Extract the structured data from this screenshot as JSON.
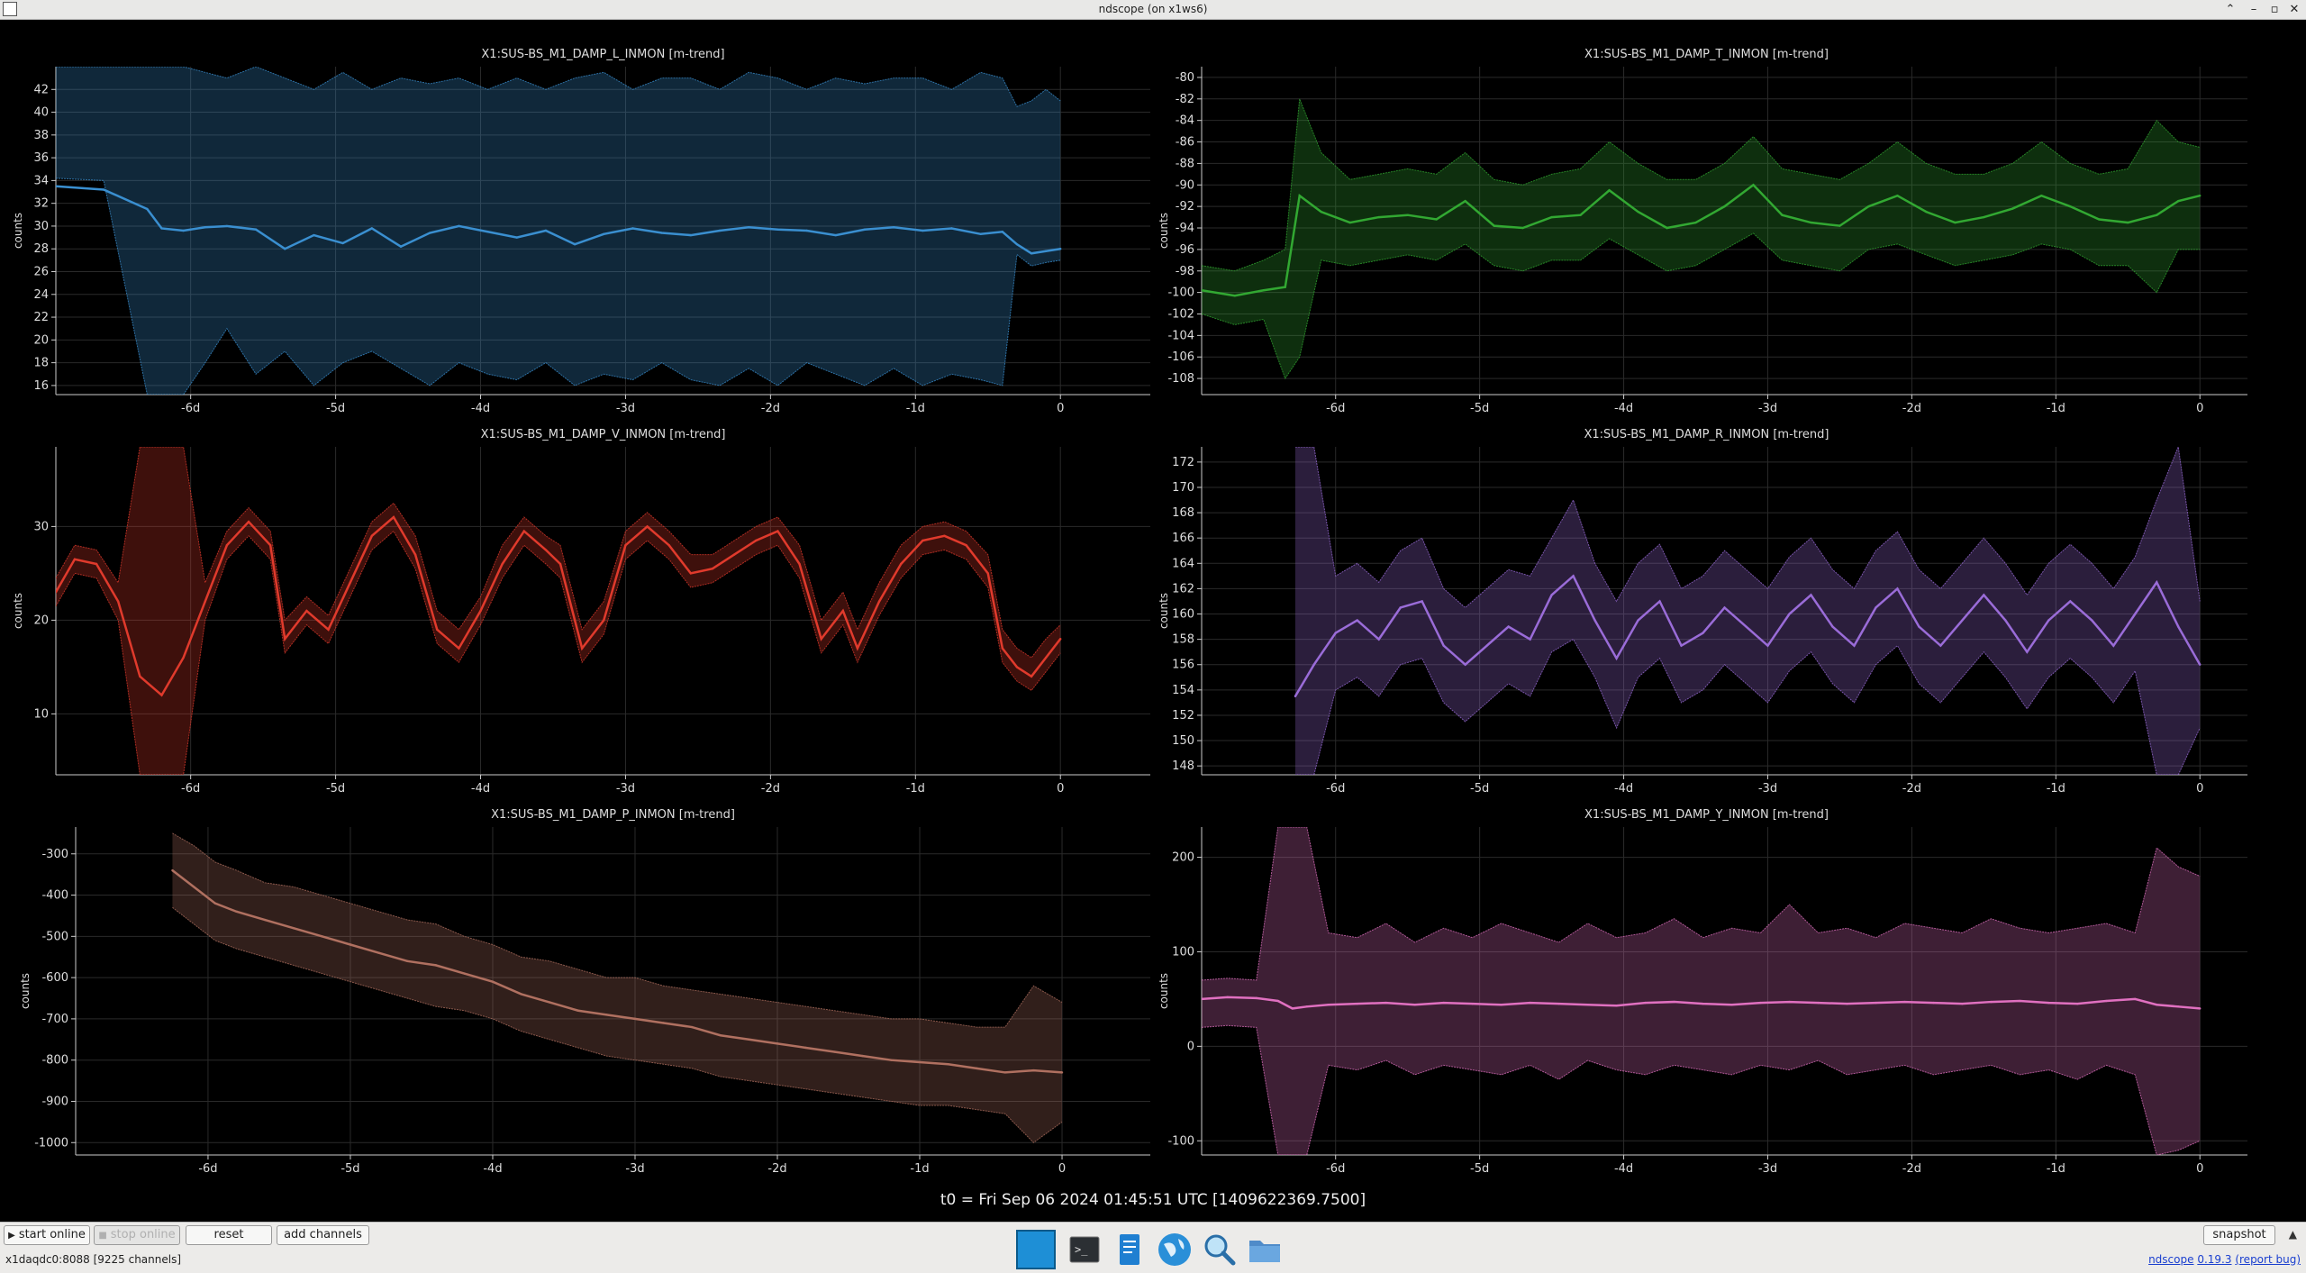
{
  "window": {
    "title": "ndscope (on x1ws6)"
  },
  "colors": {
    "background": "#000000",
    "axis": "#cccccc",
    "grid": "#2a2a2a"
  },
  "t0_label": "t0 = Fri Sep 06 2024 01:45:51 UTC [1409622369.7500]",
  "toolbar": {
    "start_online": "start online",
    "stop_online": "stop online",
    "reset": "reset",
    "add_channels": "add channels",
    "snapshot": "snapshot"
  },
  "status": {
    "server": "x1daqdc0:8088  [9225 channels]",
    "version_app": "ndscope",
    "version_num": "0.19.3",
    "report_bug": "(report bug)"
  },
  "dock_icons": [
    "desktop-icon",
    "terminal-icon",
    "text-editor-icon",
    "browser-globe-icon",
    "search-icon",
    "file-manager-icon"
  ],
  "chart_data": [
    {
      "type": "line",
      "title": "X1:SUS-BS_M1_DAMP_L_INMON [m-trend]",
      "ylabel": "counts",
      "color": "#3a8fd0",
      "xticks": [
        -6,
        -5,
        -4,
        -3,
        -2,
        -1,
        0
      ],
      "xtick_labels": [
        "-6d",
        "-5d",
        "-4d",
        "-3d",
        "-2d",
        "-1d",
        "0"
      ],
      "xlim": [
        -6.93,
        0.62
      ],
      "ylim": [
        15.2,
        44
      ],
      "yticks": [
        16,
        18,
        20,
        22,
        24,
        26,
        28,
        30,
        32,
        34,
        36,
        38,
        40,
        42
      ],
      "x": [
        -6.93,
        -6.6,
        -6.3,
        -6.2,
        -6.05,
        -5.9,
        -5.75,
        -5.55,
        -5.35,
        -5.15,
        -4.95,
        -4.75,
        -4.55,
        -4.35,
        -4.15,
        -3.95,
        -3.75,
        -3.55,
        -3.35,
        -3.15,
        -2.95,
        -2.75,
        -2.55,
        -2.35,
        -2.15,
        -1.95,
        -1.75,
        -1.55,
        -1.35,
        -1.15,
        -0.95,
        -0.75,
        -0.55,
        -0.4,
        -0.3,
        -0.2,
        -0.1,
        0
      ],
      "mean": [
        33.5,
        33.2,
        31.5,
        29.8,
        29.6,
        29.9,
        30.0,
        29.7,
        28.0,
        29.2,
        28.5,
        29.8,
        28.2,
        29.4,
        30.0,
        29.5,
        29.0,
        29.6,
        28.4,
        29.3,
        29.8,
        29.4,
        29.2,
        29.6,
        29.9,
        29.7,
        29.6,
        29.2,
        29.7,
        29.9,
        29.6,
        29.8,
        29.3,
        29.5,
        28.4,
        27.6,
        27.8,
        28.0
      ],
      "max": [
        44,
        44,
        44,
        44,
        44,
        43.5,
        43,
        44,
        43,
        42,
        43.5,
        42,
        43,
        42.5,
        43,
        42,
        43,
        42,
        43,
        43.5,
        42,
        43,
        43,
        42,
        43.5,
        43,
        42,
        43,
        42.5,
        43,
        43,
        42,
        43.5,
        43,
        40.5,
        41,
        42,
        41
      ],
      "min": [
        34.2,
        34,
        15.2,
        15.2,
        15.2,
        18,
        21,
        17,
        19,
        16,
        18,
        19,
        17.5,
        16,
        18,
        17,
        16.5,
        18,
        16,
        17,
        16.5,
        18,
        16.5,
        16,
        17.5,
        16,
        18,
        17,
        16,
        17.5,
        16,
        17,
        16.5,
        16,
        27.5,
        26.5,
        26.8,
        27
      ]
    },
    {
      "type": "line",
      "title": "X1:SUS-BS_M1_DAMP_T_INMON [m-trend]",
      "ylabel": "counts",
      "color": "#32a832",
      "xticks": [
        -6,
        -5,
        -4,
        -3,
        -2,
        -1,
        0
      ],
      "xtick_labels": [
        "-6d",
        "-5d",
        "-4d",
        "-3d",
        "-2d",
        "-1d",
        "0"
      ],
      "xlim": [
        -6.93,
        0.33
      ],
      "ylim": [
        -109.5,
        -79
      ],
      "yticks": [
        -80,
        -82,
        -84,
        -86,
        -88,
        -90,
        -92,
        -94,
        -96,
        -98,
        -100,
        -102,
        -104,
        -106,
        -108
      ],
      "x": [
        -6.93,
        -6.7,
        -6.5,
        -6.35,
        -6.25,
        -6.1,
        -5.9,
        -5.7,
        -5.5,
        -5.3,
        -5.1,
        -4.9,
        -4.7,
        -4.5,
        -4.3,
        -4.1,
        -3.9,
        -3.7,
        -3.5,
        -3.3,
        -3.1,
        -2.9,
        -2.7,
        -2.5,
        -2.3,
        -2.1,
        -1.9,
        -1.7,
        -1.5,
        -1.3,
        -1.1,
        -0.9,
        -0.7,
        -0.5,
        -0.3,
        -0.15,
        0
      ],
      "mean": [
        -99.8,
        -100.3,
        -99.8,
        -99.5,
        -91.0,
        -92.5,
        -93.5,
        -93.0,
        -92.8,
        -93.2,
        -91.5,
        -93.8,
        -94.0,
        -93.0,
        -92.8,
        -90.5,
        -92.5,
        -94.0,
        -93.5,
        -92.0,
        -90.0,
        -92.8,
        -93.5,
        -93.8,
        -92.0,
        -91.0,
        -92.5,
        -93.5,
        -93.0,
        -92.2,
        -91.0,
        -92.0,
        -93.2,
        -93.5,
        -92.8,
        -91.5,
        -91.0
      ],
      "max": [
        -97.5,
        -98,
        -97,
        -96,
        -82,
        -87,
        -89.5,
        -89,
        -88.5,
        -89,
        -87,
        -89.5,
        -90,
        -89,
        -88.5,
        -86,
        -88,
        -89.5,
        -89.5,
        -88,
        -85.5,
        -88.5,
        -89,
        -89.5,
        -88,
        -86,
        -88,
        -89,
        -89,
        -88,
        -86,
        -88,
        -89,
        -88.5,
        -84,
        -86,
        -86.5
      ],
      "min": [
        -102,
        -103,
        -102.5,
        -108,
        -106,
        -97,
        -97.5,
        -97,
        -96.5,
        -97,
        -95.5,
        -97.5,
        -98,
        -97,
        -97,
        -95,
        -96.5,
        -98,
        -97.5,
        -96,
        -94.5,
        -97,
        -97.5,
        -98,
        -96,
        -95.5,
        -96.5,
        -97.5,
        -97,
        -96.5,
        -95.5,
        -96,
        -97.5,
        -97.5,
        -100,
        -96,
        -96
      ]
    },
    {
      "type": "line",
      "title": "X1:SUS-BS_M1_DAMP_V_INMON [m-trend]",
      "ylabel": "counts",
      "color": "#e03a2c",
      "xticks": [
        -6,
        -5,
        -4,
        -3,
        -2,
        -1,
        0
      ],
      "xtick_labels": [
        "-6d",
        "-5d",
        "-4d",
        "-3d",
        "-2d",
        "-1d",
        "0"
      ],
      "xlim": [
        -6.93,
        0.62
      ],
      "ylim": [
        3.5,
        38.5
      ],
      "yticks": [
        10,
        20,
        30
      ],
      "x": [
        -6.93,
        -6.8,
        -6.65,
        -6.5,
        -6.35,
        -6.2,
        -6.05,
        -5.9,
        -5.75,
        -5.6,
        -5.45,
        -5.35,
        -5.2,
        -5.05,
        -4.9,
        -4.75,
        -4.6,
        -4.45,
        -4.3,
        -4.15,
        -4.0,
        -3.85,
        -3.7,
        -3.55,
        -3.45,
        -3.3,
        -3.15,
        -3.0,
        -2.85,
        -2.7,
        -2.55,
        -2.4,
        -2.25,
        -2.1,
        -1.95,
        -1.8,
        -1.65,
        -1.5,
        -1.4,
        -1.25,
        -1.1,
        -0.95,
        -0.8,
        -0.65,
        -0.5,
        -0.4,
        -0.3,
        -0.2,
        -0.1,
        0
      ],
      "mean": [
        23,
        26.5,
        26,
        22,
        14,
        12,
        16,
        22,
        28,
        30.5,
        28,
        18,
        21,
        19,
        24,
        29,
        31,
        27,
        19,
        17,
        21,
        26,
        29.5,
        27.5,
        26,
        17,
        20,
        28,
        30,
        28,
        25,
        25.5,
        27,
        28.5,
        29.5,
        26,
        18,
        21,
        17,
        22,
        26,
        28.5,
        29,
        28,
        25,
        17,
        15,
        14,
        16,
        18
      ],
      "max": [
        24.5,
        28,
        27.5,
        24,
        38.5,
        38.5,
        38.5,
        24,
        29.5,
        32,
        29.5,
        20,
        22.5,
        20.5,
        25.5,
        30.5,
        32.5,
        29,
        21,
        19,
        22.5,
        28,
        31,
        29,
        28,
        19,
        22,
        29.5,
        31.5,
        29.5,
        27,
        27,
        28.5,
        30,
        31,
        28,
        20,
        23,
        19,
        24,
        28,
        30,
        30.5,
        29.5,
        27,
        19,
        17,
        16,
        18,
        19.5
      ],
      "min": [
        21.5,
        25,
        24.5,
        20,
        3.5,
        3.5,
        3.5,
        20,
        26.5,
        29,
        26.5,
        16.5,
        19.5,
        17.5,
        22.5,
        27.5,
        29.5,
        25.5,
        17.5,
        15.5,
        19.5,
        24.5,
        28,
        26,
        24.5,
        15.5,
        18.5,
        26.5,
        28.5,
        26.5,
        23.5,
        24,
        25.5,
        27,
        28,
        24.5,
        16.5,
        19.5,
        15.5,
        20.5,
        24.5,
        27,
        27.5,
        26.5,
        23.5,
        15.5,
        13.5,
        12.5,
        14.5,
        16.5
      ]
    },
    {
      "type": "line",
      "title": "X1:SUS-BS_M1_DAMP_R_INMON [m-trend]",
      "ylabel": "counts",
      "color": "#9a6cd8",
      "xticks": [
        -6,
        -5,
        -4,
        -3,
        -2,
        -1,
        0
      ],
      "xtick_labels": [
        "-6d",
        "-5d",
        "-4d",
        "-3d",
        "-2d",
        "-1d",
        "0"
      ],
      "xlim": [
        -6.93,
        0.33
      ],
      "ylim": [
        147.3,
        173.2
      ],
      "yticks": [
        148,
        150,
        152,
        154,
        156,
        158,
        160,
        162,
        164,
        166,
        168,
        170,
        172
      ],
      "x": [
        -6.28,
        -6.15,
        -6.0,
        -5.85,
        -5.7,
        -5.55,
        -5.4,
        -5.25,
        -5.1,
        -4.95,
        -4.8,
        -4.65,
        -4.5,
        -4.35,
        -4.2,
        -4.05,
        -3.9,
        -3.75,
        -3.6,
        -3.45,
        -3.3,
        -3.15,
        -3.0,
        -2.85,
        -2.7,
        -2.55,
        -2.4,
        -2.25,
        -2.1,
        -1.95,
        -1.8,
        -1.65,
        -1.5,
        -1.35,
        -1.2,
        -1.05,
        -0.9,
        -0.75,
        -0.6,
        -0.45,
        -0.3,
        -0.15,
        0
      ],
      "mean": [
        153.5,
        156,
        158.5,
        159.5,
        158,
        160.5,
        161,
        157.5,
        156,
        157.5,
        159,
        158,
        161.5,
        163,
        159.5,
        156.5,
        159.5,
        161,
        157.5,
        158.5,
        160.5,
        159,
        157.5,
        160,
        161.5,
        159,
        157.5,
        160.5,
        162,
        159,
        157.5,
        159.5,
        161.5,
        159.5,
        157,
        159.5,
        161,
        159.5,
        157.5,
        160,
        162.5,
        159,
        156
      ],
      "max": [
        173.2,
        173.2,
        163,
        164,
        162.5,
        165,
        166,
        162,
        160.5,
        162,
        163.5,
        163,
        166,
        169,
        164,
        161,
        164,
        165.5,
        162,
        163,
        165,
        163.5,
        162,
        164.5,
        166,
        163.5,
        162,
        165,
        166.5,
        163.5,
        162,
        164,
        166,
        164,
        161.5,
        164,
        165.5,
        164,
        162,
        164.5,
        169,
        173.2,
        161
      ],
      "min": [
        147.3,
        147.3,
        154,
        155,
        153.5,
        156,
        156.5,
        153,
        151.5,
        153,
        154.5,
        153.5,
        157,
        158,
        155,
        151,
        155,
        156.5,
        153,
        154,
        156,
        154.5,
        153,
        155.5,
        157,
        154.5,
        153,
        156,
        157.5,
        154.5,
        153,
        155,
        157,
        155,
        152.5,
        155,
        156.5,
        155,
        153,
        155.5,
        147.3,
        147.3,
        151
      ]
    },
    {
      "type": "line",
      "title": "X1:SUS-BS_M1_DAMP_P_INMON [m-trend]",
      "ylabel": "counts",
      "color": "#b07060",
      "xticks": [
        -6,
        -5,
        -4,
        -3,
        -2,
        -1,
        0
      ],
      "xtick_labels": [
        "-6d",
        "-5d",
        "-4d",
        "-3d",
        "-2d",
        "-1d",
        "0"
      ],
      "xlim": [
        -6.93,
        0.62
      ],
      "ylim": [
        -1030,
        -235
      ],
      "yticks": [
        -300,
        -400,
        -500,
        -600,
        -700,
        -800,
        -900,
        -1000
      ],
      "x": [
        -6.25,
        -6.1,
        -5.95,
        -5.8,
        -5.6,
        -5.4,
        -5.2,
        -5.0,
        -4.8,
        -4.6,
        -4.4,
        -4.2,
        -4.0,
        -3.8,
        -3.6,
        -3.4,
        -3.2,
        -3.0,
        -2.8,
        -2.6,
        -2.4,
        -2.2,
        -2.0,
        -1.8,
        -1.6,
        -1.4,
        -1.2,
        -1.0,
        -0.8,
        -0.6,
        -0.4,
        -0.2,
        0
      ],
      "mean": [
        -340,
        -380,
        -420,
        -440,
        -460,
        -480,
        -500,
        -520,
        -540,
        -560,
        -570,
        -590,
        -610,
        -640,
        -660,
        -680,
        -690,
        -700,
        -710,
        -720,
        -740,
        -750,
        -760,
        -770,
        -780,
        -790,
        -800,
        -805,
        -810,
        -820,
        -830,
        -825,
        -830
      ],
      "max": [
        -250,
        -280,
        -320,
        -340,
        -370,
        -380,
        -400,
        -420,
        -440,
        -460,
        -470,
        -500,
        -520,
        -550,
        -560,
        -580,
        -600,
        -600,
        -620,
        -630,
        -640,
        -650,
        -660,
        -670,
        -680,
        -690,
        -700,
        -700,
        -710,
        -720,
        -720,
        -620,
        -660
      ],
      "min": [
        -430,
        -470,
        -510,
        -530,
        -550,
        -570,
        -590,
        -610,
        -630,
        -650,
        -670,
        -680,
        -700,
        -730,
        -750,
        -770,
        -790,
        -800,
        -810,
        -820,
        -840,
        -850,
        -860,
        -870,
        -880,
        -890,
        -900,
        -910,
        -910,
        -920,
        -930,
        -1000,
        -950
      ]
    },
    {
      "type": "line",
      "title": "X1:SUS-BS_M1_DAMP_Y_INMON [m-trend]",
      "ylabel": "counts",
      "color": "#e070c0",
      "xticks": [
        -6,
        -5,
        -4,
        -3,
        -2,
        -1,
        0
      ],
      "xtick_labels": [
        "-6d",
        "-5d",
        "-4d",
        "-3d",
        "-2d",
        "-1d",
        "0"
      ],
      "xlim": [
        -6.93,
        0.33
      ],
      "ylim": [
        -115,
        232
      ],
      "yticks": [
        200,
        100,
        0,
        -100
      ],
      "x": [
        -6.93,
        -6.75,
        -6.55,
        -6.4,
        -6.3,
        -6.2,
        -6.05,
        -5.85,
        -5.65,
        -5.45,
        -5.25,
        -5.05,
        -4.85,
        -4.65,
        -4.45,
        -4.25,
        -4.05,
        -3.85,
        -3.65,
        -3.45,
        -3.25,
        -3.05,
        -2.85,
        -2.65,
        -2.45,
        -2.25,
        -2.05,
        -1.85,
        -1.65,
        -1.45,
        -1.25,
        -1.05,
        -0.85,
        -0.65,
        -0.45,
        -0.3,
        -0.15,
        0
      ],
      "mean": [
        50,
        52,
        51,
        48,
        40,
        42,
        44,
        45,
        46,
        44,
        46,
        45,
        44,
        46,
        45,
        44,
        43,
        46,
        47,
        45,
        44,
        46,
        47,
        46,
        45,
        46,
        47,
        46,
        45,
        47,
        48,
        46,
        45,
        48,
        50,
        44,
        42,
        40
      ],
      "max": [
        70,
        72,
        70,
        232,
        232,
        232,
        120,
        115,
        130,
        110,
        125,
        115,
        130,
        120,
        110,
        130,
        115,
        120,
        135,
        115,
        125,
        120,
        150,
        120,
        125,
        115,
        130,
        125,
        120,
        135,
        125,
        120,
        125,
        130,
        120,
        210,
        190,
        180
      ],
      "min": [
        20,
        22,
        20,
        -115,
        -115,
        -115,
        -20,
        -25,
        -15,
        -30,
        -20,
        -25,
        -30,
        -20,
        -35,
        -15,
        -25,
        -30,
        -20,
        -25,
        -30,
        -20,
        -25,
        -15,
        -30,
        -25,
        -20,
        -30,
        -25,
        -20,
        -30,
        -25,
        -35,
        -20,
        -30,
        -115,
        -110,
        -100
      ]
    }
  ]
}
